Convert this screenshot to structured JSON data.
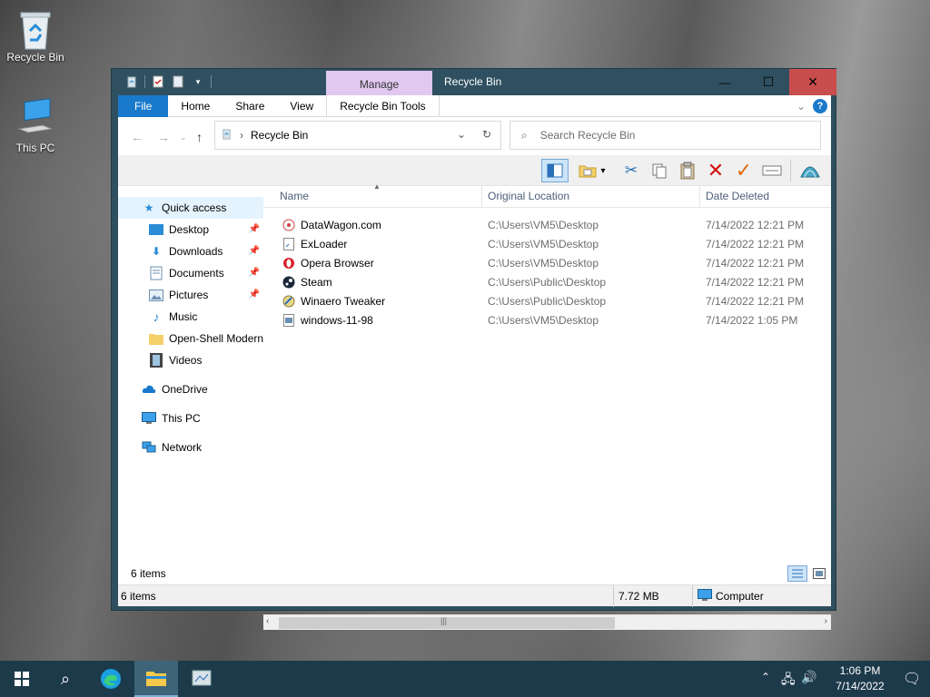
{
  "desktop": {
    "icons": [
      {
        "label": "Recycle Bin"
      },
      {
        "label": "This PC"
      }
    ]
  },
  "window": {
    "title": "Recycle Bin",
    "context_tab": "Manage",
    "controls": {
      "minimize": "—",
      "maximize": "☐",
      "close": "✕"
    }
  },
  "ribbon": {
    "tabs": [
      "File",
      "Home",
      "Share",
      "View",
      "Recycle Bin Tools"
    ],
    "collapse_icon": "chevron-down",
    "help": "?"
  },
  "address": {
    "path": "Recycle Bin",
    "search_placeholder": "Search Recycle Bin"
  },
  "navpane": {
    "items": [
      {
        "label": "Quick access",
        "icon": "star-icon",
        "pinned": false
      },
      {
        "label": "Desktop",
        "icon": "desktop-folder-icon",
        "pinned": true
      },
      {
        "label": "Downloads",
        "icon": "downloads-icon",
        "pinned": true
      },
      {
        "label": "Documents",
        "icon": "documents-icon",
        "pinned": true
      },
      {
        "label": "Pictures",
        "icon": "pictures-icon",
        "pinned": true
      },
      {
        "label": "Music",
        "icon": "music-icon",
        "pinned": false
      },
      {
        "label": "Open-Shell Modern",
        "icon": "folder-icon",
        "pinned": false
      },
      {
        "label": "Videos",
        "icon": "videos-icon",
        "pinned": false
      },
      {
        "label": "OneDrive",
        "icon": "cloud-icon",
        "pinned": false
      },
      {
        "label": "This PC",
        "icon": "computer-icon",
        "pinned": false
      },
      {
        "label": "Network",
        "icon": "network-icon",
        "pinned": false
      }
    ]
  },
  "columns": {
    "name": "Name",
    "original_location": "Original Location",
    "date_deleted": "Date Deleted"
  },
  "files": [
    {
      "name": "DataWagon.com",
      "location": "C:\\Users\\VM5\\Desktop",
      "date": "7/14/2022 12:21 PM"
    },
    {
      "name": "ExLoader",
      "location": "C:\\Users\\VM5\\Desktop",
      "date": "7/14/2022 12:21 PM"
    },
    {
      "name": "Opera Browser",
      "location": "C:\\Users\\VM5\\Desktop",
      "date": "7/14/2022 12:21 PM"
    },
    {
      "name": "Steam",
      "location": "C:\\Users\\Public\\Desktop",
      "date": "7/14/2022 12:21 PM"
    },
    {
      "name": "Winaero Tweaker",
      "location": "C:\\Users\\Public\\Desktop",
      "date": "7/14/2022 12:21 PM"
    },
    {
      "name": "windows-11-98",
      "location": "C:\\Users\\VM5\\Desktop",
      "date": "7/14/2022 1:05 PM"
    }
  ],
  "status": {
    "count_inner": "6 items",
    "count_outer": "6 items",
    "size": "7.72 MB",
    "zone": "Computer"
  },
  "taskbar": {
    "time": "1:06 PM",
    "date": "7/14/2022"
  }
}
